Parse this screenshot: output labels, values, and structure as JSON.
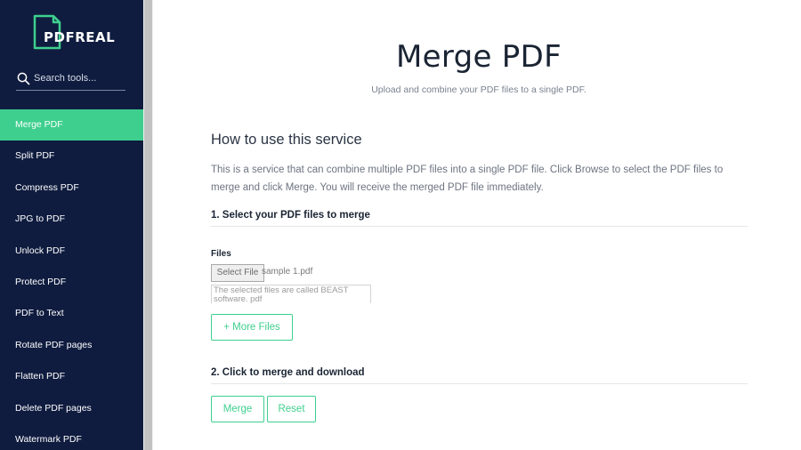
{
  "sidebar": {
    "logo_text": "PDFREAL",
    "search_placeholder": "Search tools...",
    "items": [
      {
        "label": "Merge PDF",
        "active": true
      },
      {
        "label": "Split PDF"
      },
      {
        "label": "Compress PDF"
      },
      {
        "label": "JPG to PDF"
      },
      {
        "label": "Unlock PDF"
      },
      {
        "label": "Protect PDF"
      },
      {
        "label": "PDF to Text"
      },
      {
        "label": "Rotate PDF pages"
      },
      {
        "label": "Flatten PDF"
      },
      {
        "label": "Delete PDF pages"
      },
      {
        "label": "Watermark PDF"
      }
    ]
  },
  "main": {
    "title": "Merge PDF",
    "subtitle": "Upload and combine your PDF files to a single PDF.",
    "howto_title": "How to use this service",
    "howto_desc": "This is a service that can combine multiple PDF files into a single PDF file. Click Browse to select the PDF files to merge and click Merge. You will receive the merged PDF file immediately.",
    "step1_heading": "1. Select your PDF files to merge",
    "files_label": "Files",
    "file_button": "Select File",
    "file_name": "sample 1.pdf",
    "file_note": "The selected files are called BEAST software. pdf",
    "more_files_button": "+ More Files",
    "step2_heading": "2. Click to merge and download",
    "merge_button": "Merge",
    "reset_button": "Reset"
  },
  "colors": {
    "sidebar_bg": "#0f1c3f",
    "accent": "#3ecf8e",
    "title_text": "#1a2433",
    "muted_text": "#6d7380"
  },
  "icons": [
    "pdf-file-icon",
    "search-icon"
  ]
}
